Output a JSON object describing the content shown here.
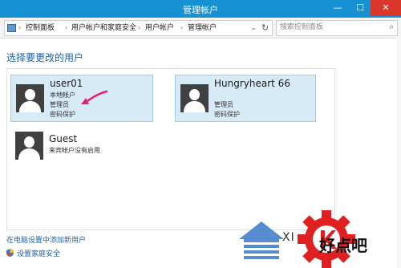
{
  "window": {
    "title": "管理帐户",
    "minimize_glyph": "—",
    "maximize_glyph": "☐",
    "close_glyph": "✕"
  },
  "address_bar": {
    "location_icon": "control-panel-icon",
    "crumbs": [
      "控制面板",
      "用户帐户和家庭安全",
      "用户帐户",
      "管理帐户"
    ],
    "separator": "›",
    "dropdown_glyph": "⌄",
    "refresh_glyph": "↻"
  },
  "search": {
    "placeholder": "搜索控制面板",
    "icon": "search-icon",
    "glyph": "⌕"
  },
  "heading": "选择要更改的用户",
  "users": [
    {
      "name": "user01",
      "lines": [
        "本地帐户",
        "管理员",
        "密码保护"
      ],
      "selected": true
    },
    {
      "name": "Hungryheart 66",
      "lines": [
        "管理员",
        "密码保护"
      ],
      "selected": true
    },
    {
      "name": "Guest",
      "lines": [
        "来宾帐户没有启用"
      ],
      "selected": false
    }
  ],
  "links": {
    "add_user": "在电脑设置中添加新用户",
    "family_safety": "设置家庭安全"
  },
  "watermark": {
    "brand": "好点吧",
    "letters": "XI"
  },
  "colors": {
    "title_bar": "#1692d4",
    "link": "#1e5fa8",
    "selected_card": "#d7ebf7",
    "selected_border": "#9dcde7",
    "arrow": "#e6207a",
    "watermark_gear": "#e02020",
    "watermark_blue": "#3a78c8"
  }
}
